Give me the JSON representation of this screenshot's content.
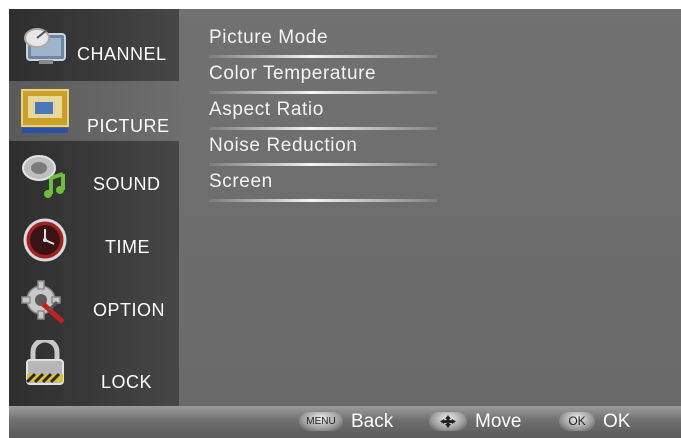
{
  "sidebar": {
    "items": [
      {
        "label": "CHANNEL",
        "icon": "channel-satellite-icon"
      },
      {
        "label": "PICTURE",
        "icon": "picture-icon",
        "selected": true
      },
      {
        "label": "SOUND",
        "icon": "sound-icon"
      },
      {
        "label": "TIME",
        "icon": "clock-icon"
      },
      {
        "label": "OPTION",
        "icon": "gear-tools-icon"
      },
      {
        "label": "LOCK",
        "icon": "padlock-icon"
      }
    ]
  },
  "main": {
    "items": [
      {
        "label": "Picture Mode"
      },
      {
        "label": "Color Temperature"
      },
      {
        "label": "Aspect Ratio"
      },
      {
        "label": "Noise Reduction"
      },
      {
        "label": "Screen"
      }
    ]
  },
  "footer": {
    "menu_key": "MENU",
    "menu_label": "Back",
    "move_label": "Move",
    "ok_key": "OK",
    "ok_label": "OK"
  },
  "colors": {
    "sidebar_bg": "#3a3a3a",
    "main_bg": "#6f6f6f",
    "text": "#ffffff"
  }
}
